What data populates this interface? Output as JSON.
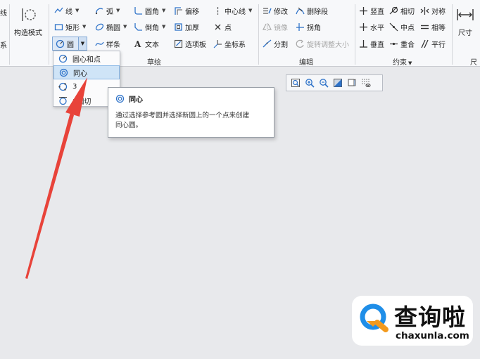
{
  "ribbon": {
    "left_edge": [
      "线",
      "系"
    ],
    "construct_mode": "构造模式",
    "sketch": {
      "line": "线",
      "arc": "弧",
      "fillet": "圆角",
      "offset": "偏移",
      "centerline": "中心线",
      "rectangle": "矩形",
      "ellipse": "椭圆",
      "chamfer": "倒角",
      "thicken": "加厚",
      "point": "点",
      "circle": "圆",
      "spline": "样条",
      "text": "文本",
      "palette": "选项板",
      "coord_sys": "坐标系",
      "group_label": "草绘"
    },
    "edit": {
      "modify": "修改",
      "delete_segment": "删除段",
      "mirror": "镜像",
      "corner": "拐角",
      "divide": "分割",
      "rotate_resize": "旋转调整大小",
      "group_label": "编辑"
    },
    "constrain": {
      "vertical": "竖直",
      "tangent": "相切",
      "symmetric": "对称",
      "horizontal": "水平",
      "midpoint": "中点",
      "equal": "相等",
      "perpendicular": "垂直",
      "coincident": "重合",
      "parallel": "平行",
      "group_label": "约束"
    },
    "dimension": {
      "label": "尺寸",
      "group_label_partial": "尺"
    }
  },
  "dropdown": {
    "items": [
      {
        "label": "圆心和点"
      },
      {
        "label": "同心"
      },
      {
        "label": "3"
      },
      {
        "label": "3相切"
      }
    ]
  },
  "tooltip": {
    "title": "同心",
    "body_line1": "通过选择参考圆并选择新圆上的一个点来创建",
    "body_line2": "同心圆。"
  },
  "watermark": {
    "cn": "查询啦",
    "en": "chaxunla.com"
  },
  "colors": {
    "arrow": "#e8433a",
    "accent_blue": "#2f73c9",
    "logo_blue": "#1f8ee8",
    "logo_orange": "#f39a1d"
  }
}
